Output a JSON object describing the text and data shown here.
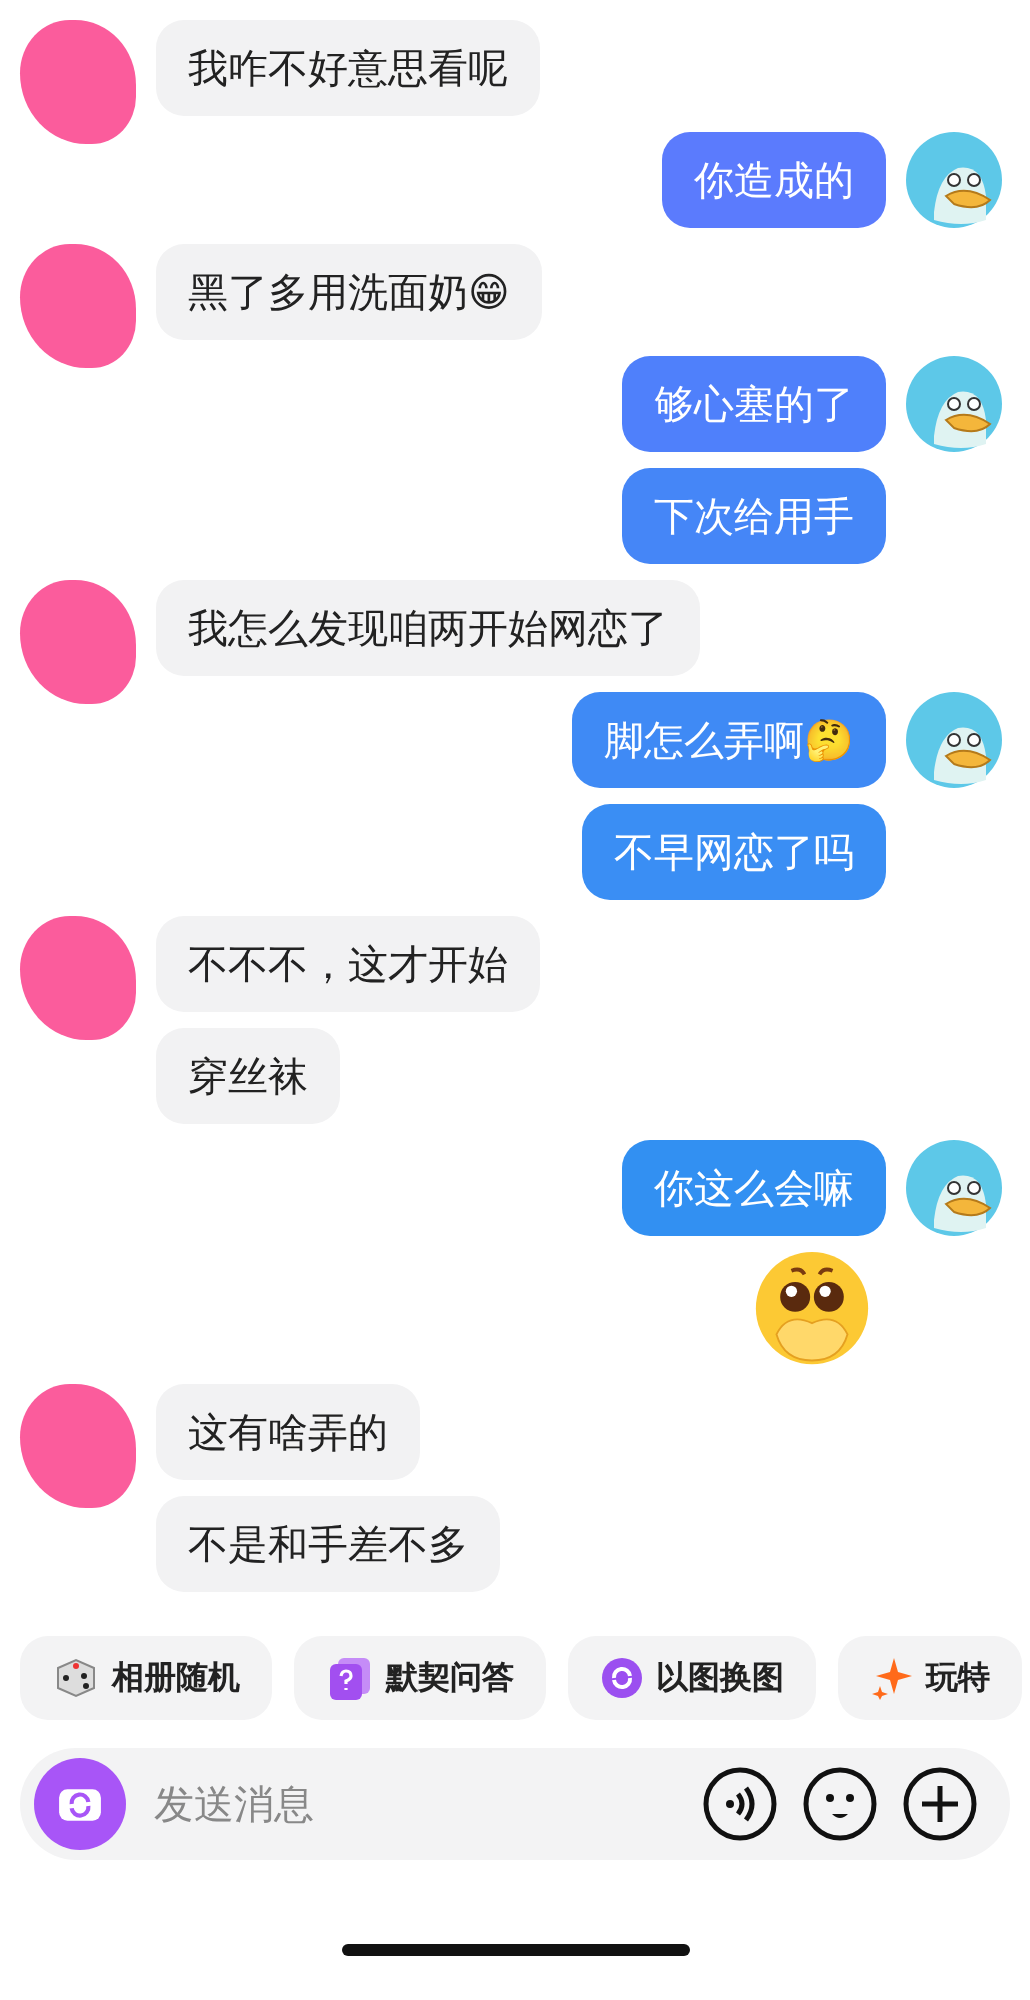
{
  "messages": [
    {
      "kind": "incoming",
      "texts": [
        "我咋不好意思看呢"
      ]
    },
    {
      "kind": "outgoing",
      "texts": [
        "你造成的"
      ]
    },
    {
      "kind": "incoming",
      "texts": [
        "黑了多用洗面奶😁"
      ]
    },
    {
      "kind": "outgoing",
      "texts": [
        "够心塞的了",
        "下次给用手"
      ]
    },
    {
      "kind": "incoming",
      "texts": [
        "我怎么发现咱两开始网恋了"
      ]
    },
    {
      "kind": "outgoing",
      "texts": [
        "脚怎么弄啊🤔",
        "不早网恋了吗"
      ]
    },
    {
      "kind": "incoming",
      "texts": [
        "不不不，这才开始",
        "穿丝袜"
      ]
    },
    {
      "kind": "outgoing",
      "texts": [
        "你这么会嘛"
      ]
    },
    {
      "kind": "sticker"
    },
    {
      "kind": "incoming",
      "texts": [
        "这有啥弄的",
        "不是和手差不多"
      ]
    }
  ],
  "quick_actions": [
    "相册随机",
    "默契问答",
    "以图换图",
    "玩特"
  ],
  "composer": {
    "placeholder": "发送消息"
  }
}
